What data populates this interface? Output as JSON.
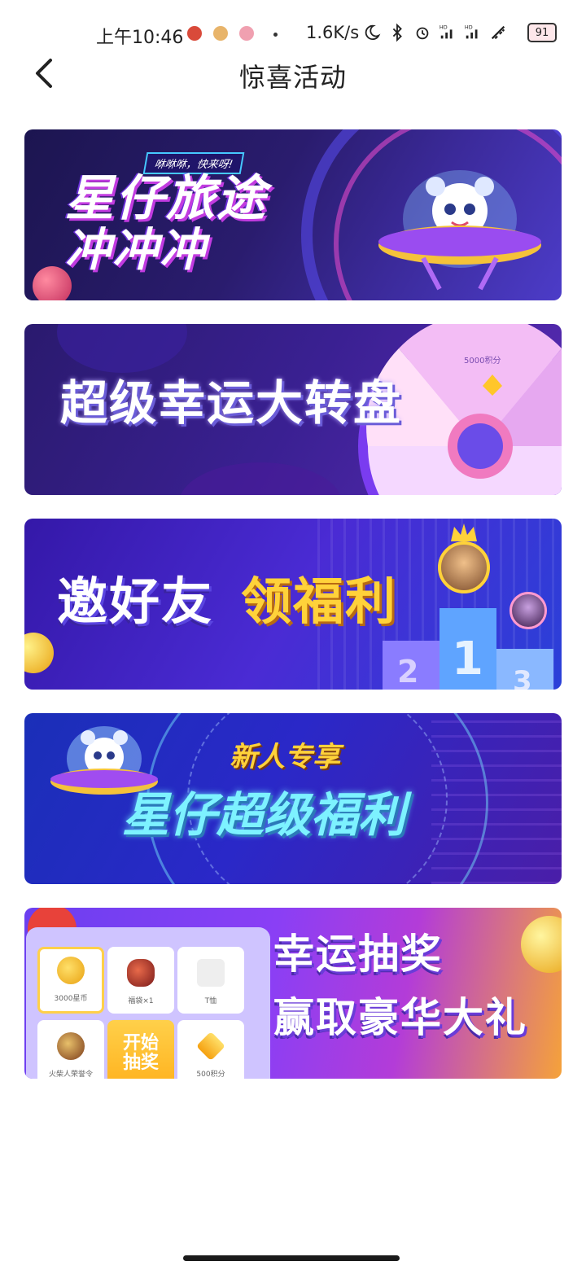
{
  "status_bar": {
    "time": "上午10:46",
    "net_speed": "1.6K/s",
    "battery": "91",
    "icons": [
      "moon-icon",
      "bluetooth-icon",
      "alarm-icon",
      "signal-hd-icon",
      "signal-hd-icon",
      "wifi-icon",
      "battery-icon"
    ]
  },
  "nav": {
    "title": "惊喜活动"
  },
  "banners": [
    {
      "title_line1": "星仔旅途",
      "title_line2": "冲冲冲",
      "tag": "咻咻咻，快来呀!"
    },
    {
      "title": "超级幸运大转盘",
      "wheel_label": "5000积分"
    },
    {
      "title_a": "邀好友",
      "title_b": "领福利",
      "podium_first": "1",
      "podium_second": "2",
      "podium_third": "3"
    },
    {
      "subtitle": "新人专享",
      "title": "星仔超级福利"
    },
    {
      "title_line1": "幸运抽奖",
      "title_line2": "赢取豪华大礼",
      "cells": [
        "3000星币",
        "福袋×1",
        "T恤",
        "火柴人荣誉令",
        "500积分"
      ],
      "start_line1": "开始",
      "start_line2": "抽奖"
    }
  ],
  "colors": {
    "accent_pink": "#c13be0",
    "accent_gold": "#ffd23a",
    "accent_teal": "#7df2ff"
  }
}
